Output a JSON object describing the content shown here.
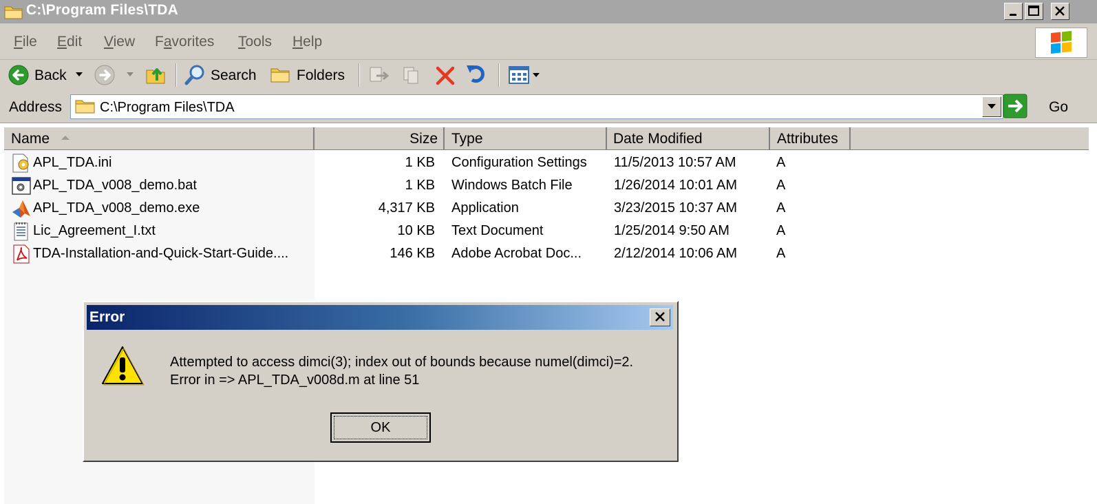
{
  "window": {
    "title": "C:\\Program Files\\TDA"
  },
  "menu": {
    "items": [
      {
        "label": "File",
        "u": "F",
        "rest": "ile"
      },
      {
        "label": "Edit",
        "u": "E",
        "rest": "dit"
      },
      {
        "label": "View",
        "u": "V",
        "rest": "iew"
      },
      {
        "label": "Favorites",
        "pre": "F",
        "u": "a",
        "rest": "vorites"
      },
      {
        "label": "Tools",
        "u": "T",
        "rest": "ools"
      },
      {
        "label": "Help",
        "u": "H",
        "rest": "elp"
      }
    ]
  },
  "toolbar": {
    "back_label": "Back",
    "search_label": "Search",
    "folders_label": "Folders"
  },
  "address": {
    "label": "Address",
    "value": "C:\\Program Files\\TDA",
    "go_label": "Go"
  },
  "list": {
    "columns": [
      "Name",
      "Size",
      "Type",
      "Date Modified",
      "Attributes"
    ],
    "rows": [
      {
        "name": "APL_TDA.ini",
        "size": "1 KB",
        "type": "Configuration Settings",
        "date": "11/5/2013 10:57 AM",
        "attr": "A",
        "icon": "ini-file-icon"
      },
      {
        "name": "APL_TDA_v008_demo.bat",
        "size": "1 KB",
        "type": "Windows Batch File",
        "date": "1/26/2014 10:01 AM",
        "attr": "A",
        "icon": "batch-file-icon"
      },
      {
        "name": "APL_TDA_v008_demo.exe",
        "size": "4,317 KB",
        "type": "Application",
        "date": "3/23/2015 10:37 AM",
        "attr": "A",
        "icon": "matlab-app-icon"
      },
      {
        "name": "Lic_Agreement_I.txt",
        "size": "10 KB",
        "type": "Text Document",
        "date": "1/25/2014 9:50 AM",
        "attr": "A",
        "icon": "text-file-icon"
      },
      {
        "name": "TDA-Installation-and-Quick-Start-Guide....",
        "size": "146 KB",
        "type": "Adobe Acrobat Doc...",
        "date": "2/12/2014 10:06 AM",
        "attr": "A",
        "icon": "pdf-file-icon"
      }
    ]
  },
  "dialog": {
    "title": "Error",
    "message_line1": "Attempted to access dimci(3); index out of bounds because numel(dimci)=2.",
    "message_line2": "Error in => APL_TDA_v008d.m at line 51",
    "ok_label": "OK",
    "icon": "warning-icon"
  },
  "colors": {
    "dialog_title_start": "#0a246a",
    "dialog_title_end": "#a6caf0",
    "chrome": "#d4d0c8"
  }
}
